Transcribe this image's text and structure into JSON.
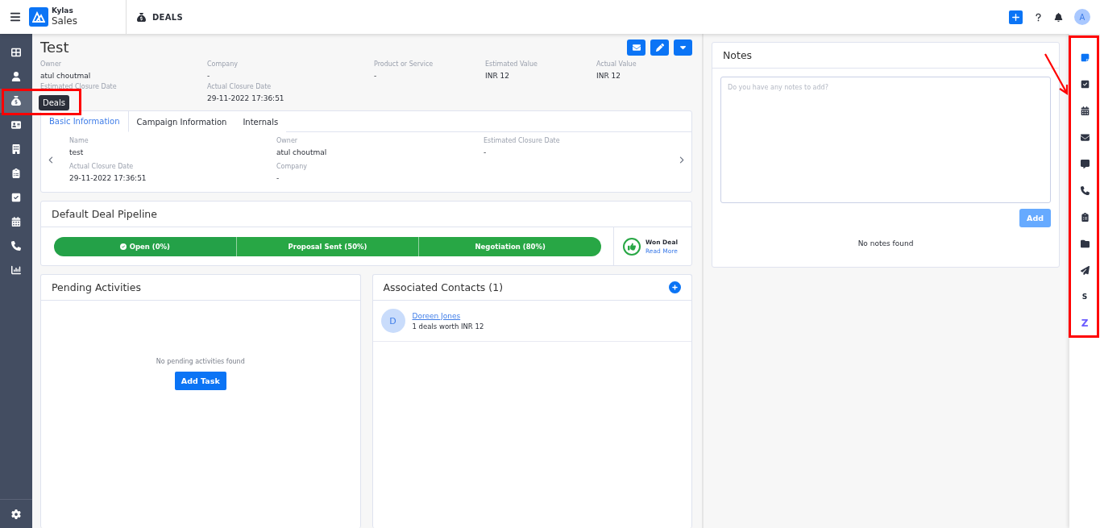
{
  "topbar": {
    "brand_top": "Kylas",
    "brand_bottom": "Sales",
    "module": "DEALS",
    "avatar": "A"
  },
  "sidebar": {
    "items": [
      {
        "selected": false
      },
      {
        "selected": false
      },
      {
        "selected": true
      },
      {
        "selected": false
      },
      {
        "selected": false
      },
      {
        "selected": false
      },
      {
        "selected": false
      },
      {
        "selected": false
      },
      {
        "selected": false
      },
      {
        "selected": false
      }
    ],
    "tooltip": "Deals"
  },
  "deal": {
    "title": "Test",
    "fields": [
      {
        "label": "Owner",
        "value": "atul choutmal"
      },
      {
        "label": "Company",
        "value": "-"
      },
      {
        "label": "Product or Service",
        "value": "-"
      },
      {
        "label": "Estimated Value",
        "value": "INR 12"
      },
      {
        "label": "Actual Value",
        "value": "INR 12"
      },
      {
        "label": "Estimated Closure Date"
      },
      {
        "label": "Actual Closure Date",
        "value": "29-11-2022 17:36:51"
      }
    ]
  },
  "tabs": [
    {
      "label": "Basic Information",
      "selected": true
    },
    {
      "label": "Campaign Information",
      "selected": false
    },
    {
      "label": "Internals",
      "selected": false
    }
  ],
  "tab_fields": [
    {
      "label": "Name",
      "value": "test"
    },
    {
      "label": "Owner",
      "value": "atul choutmal"
    },
    {
      "label": "Estimated Closure Date",
      "value": "-"
    },
    {
      "label": "Actual Closure Date",
      "value": "29-11-2022 17:36:51"
    },
    {
      "label": "Company",
      "value": "-"
    }
  ],
  "pipeline": {
    "title": "Default Deal Pipeline",
    "stages": [
      {
        "label": "Open (0%)",
        "selected": true
      },
      {
        "label": "Proposal Sent (50%)",
        "selected": false
      },
      {
        "label": "Negotiation (80%)",
        "selected": false
      }
    ],
    "won_label": "Won Deal",
    "won_link": "Read More"
  },
  "pending": {
    "title": "Pending Activities",
    "empty": "No pending activities found",
    "button": "Add Task"
  },
  "contacts": {
    "title": "Associated Contacts (1)",
    "items": [
      {
        "initial": "D",
        "name": "Doreen Jones",
        "summary": "1 deals worth INR 12"
      }
    ]
  },
  "notes": {
    "title": "Notes",
    "placeholder": "Do you have any notes to add?",
    "button": "Add",
    "empty": "No notes found"
  },
  "rail": [
    {
      "kind": "icon"
    },
    {
      "kind": "icon"
    },
    {
      "kind": "icon"
    },
    {
      "kind": "icon"
    },
    {
      "kind": "icon"
    },
    {
      "kind": "icon"
    },
    {
      "kind": "icon"
    },
    {
      "kind": "icon"
    },
    {
      "kind": "icon"
    },
    {
      "kind": "glyph",
      "text": "S"
    },
    {
      "kind": "glyph",
      "text": "Z"
    }
  ]
}
